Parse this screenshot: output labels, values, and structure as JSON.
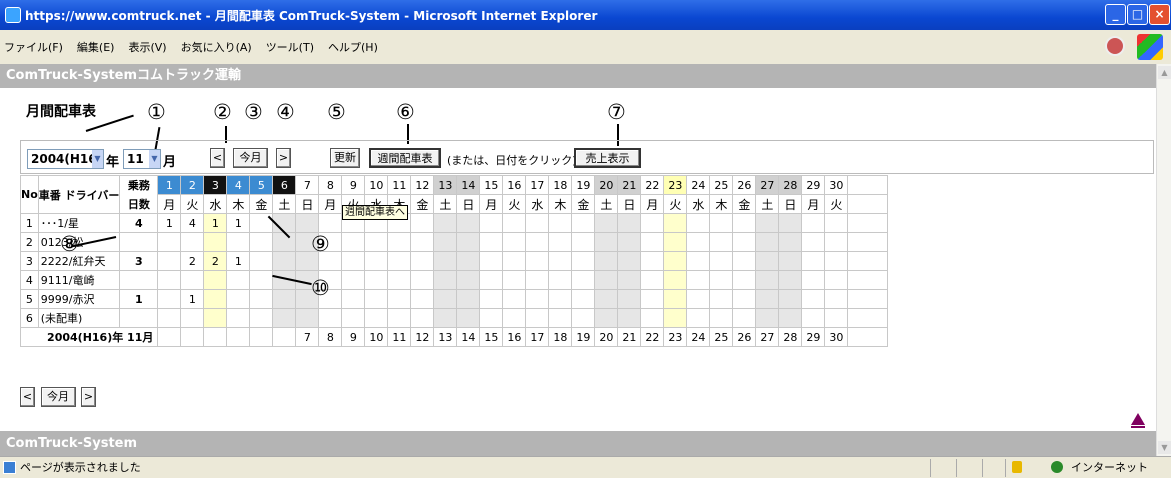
{
  "window": {
    "title": "https://www.comtruck.net - 月間配車表 ComTruck-System - Microsoft Internet Explorer"
  },
  "menu": [
    "ファイル(F)",
    "編集(E)",
    "表示(V)",
    "お気に入り(A)",
    "ツール(T)",
    "ヘルプ(H)"
  ],
  "app": {
    "header": "ComTruck-Systemコムトラック運輸",
    "footer": "ComTruck-System"
  },
  "page": {
    "title": "月間配車表"
  },
  "annotations": [
    "①",
    "②",
    "③",
    "④",
    "⑤",
    "⑥",
    "⑦",
    "⑧",
    "⑨",
    "⑩"
  ],
  "controls": {
    "year_value": "2004(H16)",
    "year_label": "年",
    "month_value": "11",
    "month_label": "月",
    "prev": "<",
    "today": "今月",
    "next": ">",
    "refresh": "更新",
    "weekly": "週間配車表",
    "note": "(または、日付をクリック)",
    "sales": "売上表示"
  },
  "table": {
    "headers": {
      "no": "No",
      "vehicle": "車番 ドライバー",
      "days_line1": "乗務",
      "days_line2": "日数"
    },
    "days": [
      "1",
      "2",
      "3",
      "4",
      "5",
      "6",
      "7",
      "8",
      "9",
      "10",
      "11",
      "12",
      "13",
      "14",
      "15",
      "16",
      "17",
      "18",
      "19",
      "20",
      "21",
      "22",
      "23",
      "24",
      "25",
      "26",
      "27",
      "28",
      "29",
      "30"
    ],
    "weekdays": [
      "月",
      "火",
      "水",
      "木",
      "金",
      "土",
      "日",
      "月",
      "火",
      "水",
      "木",
      "金",
      "土",
      "日",
      "月",
      "火",
      "水",
      "木",
      "金",
      "土",
      "日",
      "月",
      "火",
      "水",
      "木",
      "金",
      "土",
      "日",
      "月",
      "火"
    ],
    "rows": [
      {
        "no": "1",
        "name": "･･･1/星",
        "days": "4",
        "cells": {
          "1": "1",
          "2": "4",
          "3": "1",
          "4": "1"
        }
      },
      {
        "no": "2",
        "name": "0123/松",
        "days": "",
        "cells": {}
      },
      {
        "no": "3",
        "name": "2222/紅弁天",
        "days": "3",
        "cells": {
          "2": "2",
          "3": "2",
          "4": "1"
        }
      },
      {
        "no": "4",
        "name": "9111/竜崎",
        "days": "",
        "cells": {}
      },
      {
        "no": "5",
        "name": "9999/赤沢",
        "days": "1",
        "cells": {
          "2": "1"
        }
      },
      {
        "no": "6",
        "name": "(未配車)",
        "days": "",
        "cells": {}
      }
    ],
    "footer_label": "2004(H16)年 11月"
  },
  "tooltip": "週間配車表へ",
  "status": {
    "text": "ページが表示されました",
    "zone": "インターネット"
  },
  "colors": {
    "weekday_blue": "#3c8bd1",
    "today_black": "#111111",
    "weekend_gray": "#d0d0d0",
    "highlight_yellow": "#ffffb4",
    "header_bar": "#b4b4b4"
  }
}
